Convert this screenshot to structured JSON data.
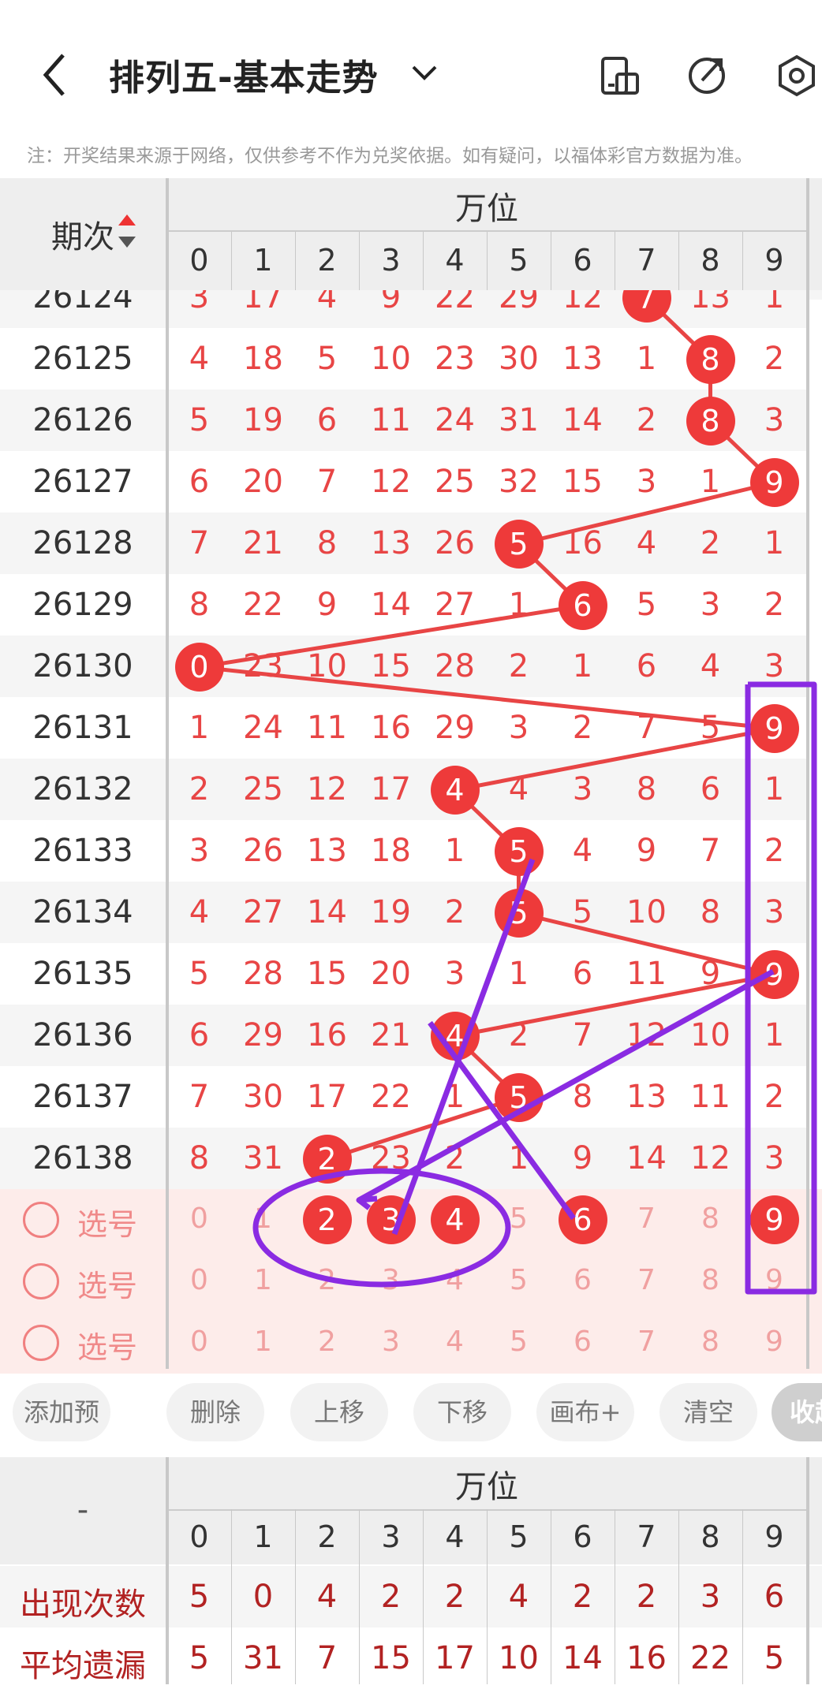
{
  "header": {
    "title": "排列五-基本走势",
    "note": "注：开奖结果来源于网络，仅供参考不作为兑奖依据。如有疑问，以福体彩官方数据为准。"
  },
  "table": {
    "period_header": "期次",
    "group_header": "万位",
    "digits": [
      "0",
      "1",
      "2",
      "3",
      "4",
      "5",
      "6",
      "7",
      "8",
      "9"
    ],
    "rows": [
      {
        "period": "26124",
        "cells": [
          "3",
          "17",
          "4",
          "9",
          "22",
          "29",
          "12",
          "7",
          "13",
          "1"
        ],
        "hit": 7
      },
      {
        "period": "26125",
        "cells": [
          "4",
          "18",
          "5",
          "10",
          "23",
          "30",
          "13",
          "1",
          "8",
          "2"
        ],
        "hit": 8
      },
      {
        "period": "26126",
        "cells": [
          "5",
          "19",
          "6",
          "11",
          "24",
          "31",
          "14",
          "2",
          "8",
          "3"
        ],
        "hit": 8
      },
      {
        "period": "26127",
        "cells": [
          "6",
          "20",
          "7",
          "12",
          "25",
          "32",
          "15",
          "3",
          "1",
          "9"
        ],
        "hit": 9
      },
      {
        "period": "26128",
        "cells": [
          "7",
          "21",
          "8",
          "13",
          "26",
          "5",
          "16",
          "4",
          "2",
          "1"
        ],
        "hit": 5
      },
      {
        "period": "26129",
        "cells": [
          "8",
          "22",
          "9",
          "14",
          "27",
          "1",
          "6",
          "5",
          "3",
          "2"
        ],
        "hit": 6
      },
      {
        "period": "26130",
        "cells": [
          "0",
          "23",
          "10",
          "15",
          "28",
          "2",
          "1",
          "6",
          "4",
          "3"
        ],
        "hit": 0
      },
      {
        "period": "26131",
        "cells": [
          "1",
          "24",
          "11",
          "16",
          "29",
          "3",
          "2",
          "7",
          "5",
          "9"
        ],
        "hit": 9
      },
      {
        "period": "26132",
        "cells": [
          "2",
          "25",
          "12",
          "17",
          "4",
          "4",
          "3",
          "8",
          "6",
          "1"
        ],
        "hit": 4
      },
      {
        "period": "26133",
        "cells": [
          "3",
          "26",
          "13",
          "18",
          "1",
          "5",
          "4",
          "9",
          "7",
          "2"
        ],
        "hit": 5
      },
      {
        "period": "26134",
        "cells": [
          "4",
          "27",
          "14",
          "19",
          "2",
          "5",
          "5",
          "10",
          "8",
          "3"
        ],
        "hit": 5
      },
      {
        "period": "26135",
        "cells": [
          "5",
          "28",
          "15",
          "20",
          "3",
          "1",
          "6",
          "11",
          "9",
          "9"
        ],
        "hit": 9
      },
      {
        "period": "26136",
        "cells": [
          "6",
          "29",
          "16",
          "21",
          "4",
          "2",
          "7",
          "12",
          "10",
          "1"
        ],
        "hit": 4
      },
      {
        "period": "26137",
        "cells": [
          "7",
          "30",
          "17",
          "22",
          "1",
          "5",
          "8",
          "13",
          "11",
          "2"
        ],
        "hit": 5
      },
      {
        "period": "26138",
        "cells": [
          "8",
          "31",
          "2",
          "23",
          "2",
          "1",
          "9",
          "14",
          "12",
          "3"
        ],
        "hit": 2
      }
    ],
    "select_label": "选号",
    "select_rows": [
      {
        "cells": [
          "0",
          "1",
          "2",
          "3",
          "4",
          "5",
          "6",
          "7",
          "8",
          "9"
        ],
        "picked": [
          2,
          3,
          4,
          6,
          9
        ]
      },
      {
        "cells": [
          "0",
          "1",
          "2",
          "3",
          "4",
          "5",
          "6",
          "7",
          "8",
          "9"
        ],
        "picked": []
      },
      {
        "cells": [
          "0",
          "1",
          "2",
          "3",
          "4",
          "5",
          "6",
          "7",
          "8",
          "9"
        ],
        "picked": []
      }
    ]
  },
  "buttons": [
    "添加预选",
    "删除",
    "上移",
    "下移",
    "画布+",
    "清空",
    "收起"
  ],
  "stats": {
    "dash": "-",
    "group_header": "万位",
    "digits": [
      "0",
      "1",
      "2",
      "3",
      "4",
      "5",
      "6",
      "7",
      "8",
      "9"
    ],
    "rows": [
      {
        "label": "出现次数",
        "values": [
          "5",
          "0",
          "4",
          "2",
          "2",
          "4",
          "2",
          "2",
          "3",
          "6"
        ]
      },
      {
        "label": "平均遗漏",
        "values": [
          "5",
          "31",
          "7",
          "15",
          "17",
          "10",
          "14",
          "16",
          "22",
          "5"
        ]
      }
    ]
  },
  "colors": {
    "accent": "#ee3a3a",
    "draw": "#8a2be2",
    "line": "#e84545"
  }
}
